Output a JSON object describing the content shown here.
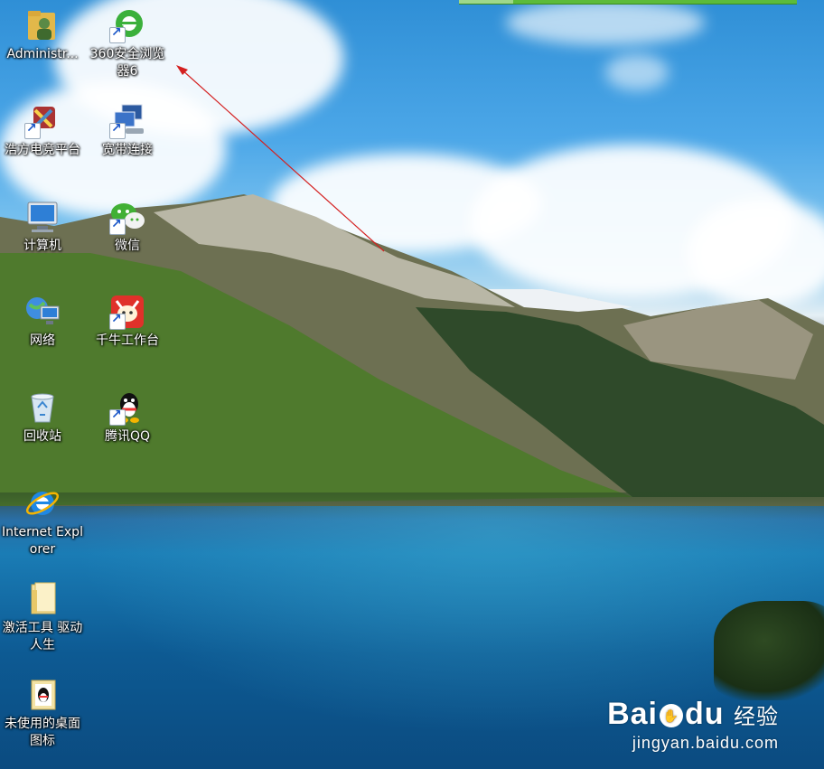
{
  "desktop": {
    "icons": [
      {
        "label": "Administr...",
        "icon": "user-folder-icon"
      },
      {
        "label": "360安全浏览器6",
        "icon": "360-browser-icon"
      },
      {
        "label": "浩方电竞平台",
        "icon": "haofang-platform-icon"
      },
      {
        "label": "宽带连接",
        "icon": "broadband-connection-icon"
      },
      {
        "label": "计算机",
        "icon": "computer-icon"
      },
      {
        "label": "微信",
        "icon": "wechat-icon"
      },
      {
        "label": "网络",
        "icon": "network-icon"
      },
      {
        "label": "千牛工作台",
        "icon": "qianniu-icon"
      },
      {
        "label": "回收站",
        "icon": "recycle-bin-icon"
      },
      {
        "label": "腾讯QQ",
        "icon": "qq-icon"
      },
      {
        "label": "Internet Explorer",
        "icon": "internet-explorer-icon"
      },
      {
        "label": "激活工具 驱动人生",
        "icon": "folder-icon"
      },
      {
        "label": "未使用的桌面图标",
        "icon": "unused-icons-folder-icon"
      }
    ]
  },
  "watermark": {
    "logo": "Bai",
    "logo_suffix": "du",
    "logo_cn": "经验",
    "url": "jingyan.baidu.com"
  },
  "colors": {
    "arrow": "#d42020",
    "taskbar_green": "#5cbb3a"
  }
}
